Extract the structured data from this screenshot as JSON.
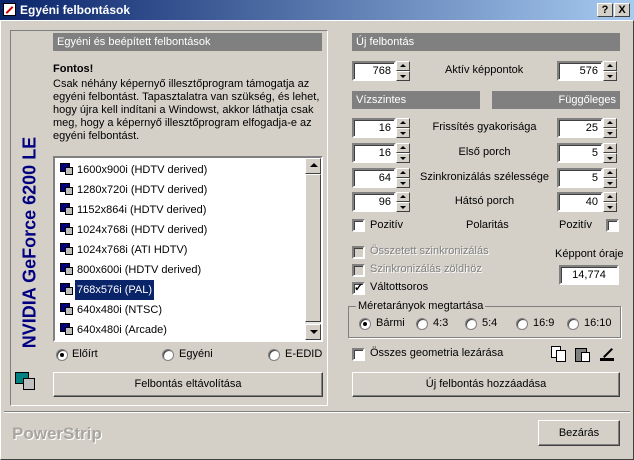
{
  "window": {
    "title": "Egyéni felbontások",
    "help_btn": "?",
    "close_btn": "X"
  },
  "sidebar": {
    "vertical_label": "NVIDIA GeForce 6200 LE"
  },
  "left": {
    "header": "Egyéni és beépített felbontások",
    "note_title": "Fontos!",
    "note_text": "Csak néhány képernyő illesztőprogram támogatja az egyéni felbontást. Tapasztalatra van szükség, és lehet, hogy újra kell indítani a Windowst, akkor láthatja csak meg, hogy a képernyő illesztőprogram elfogadja-e az egyéni felbontást.",
    "list_items": [
      "1600x900i (HDTV derived)",
      "1280x720i (HDTV derived)",
      "1152x864i (HDTV derived)",
      "1024x768i (HDTV derived)",
      "1024x768i (ATI HDTV)",
      "800x600i (HDTV derived)",
      "768x576i (PAL)",
      "640x480i (NTSC)",
      "640x480i (Arcade)"
    ],
    "selected_index": 6,
    "radios": [
      "Előírt",
      "Egyéni",
      "E-EDID"
    ],
    "radio_selected": 0,
    "remove_button": "Felbontás eltávolítása"
  },
  "right": {
    "header": "Új felbontás",
    "active_pixels_label": "Aktív képpontok",
    "h_active": "768",
    "v_active": "576",
    "horizontal_header": "Vízszintes",
    "vertical_header": "Függőleges",
    "rows": [
      {
        "label": "Frissítés gyakorisága",
        "h": "16",
        "v": "25"
      },
      {
        "label": "Első porch",
        "h": "16",
        "v": "5"
      },
      {
        "label": "Szinkronizálás szélessége",
        "h": "64",
        "v": "5"
      },
      {
        "label": "Hátsó porch",
        "h": "96",
        "v": "40"
      }
    ],
    "positive_h": "Pozitív",
    "polarity": "Polaritás",
    "positive_v": "Pozitív",
    "composite_sync": "Összetett szinkronizálás",
    "sync_on_green": "Szinkronizálás zöldhöz",
    "interlaced": "Váltottsoros",
    "pixel_clock_label": "Képpont óraje",
    "pixel_clock_value": "14,774",
    "aspect_group": "Méretarányok megtartása",
    "aspect_options": [
      "Bármi",
      "4:3",
      "5:4",
      "16:9",
      "16:10"
    ],
    "aspect_selected": 0,
    "lock_geometry": "Összes geometria lezárása",
    "add_button": "Új felbontás hozzáadása"
  },
  "footer": {
    "brand": "PowerStrip",
    "close_button": "Bezárás"
  },
  "colors": {
    "title_start": "#0a246a",
    "title_end": "#a6caf0",
    "selection": "#0a246a",
    "vertical_label": "#000080"
  }
}
